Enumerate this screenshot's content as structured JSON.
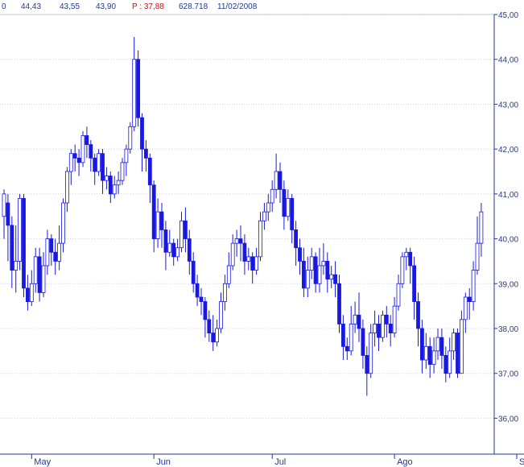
{
  "header": {
    "c0": "0",
    "c1": "44,43",
    "c2": "43,55",
    "c3": "43,90",
    "c4": "P : 37,88",
    "c5": "628.718",
    "c6": "11/02/2008"
  },
  "colors": {
    "up": "#ffffff",
    "down": "#1818e0",
    "wick": "#1818e0",
    "axis": "#203a8f",
    "grid": "#c8cde8"
  },
  "chart_data": {
    "type": "candlestick",
    "ylim": [
      35.2,
      45.0
    ],
    "y_ticks": [
      "36,00",
      "37,00",
      "38,00",
      "39,00",
      "40,00",
      "41,00",
      "42,00",
      "43,00",
      "44,00",
      "45,00"
    ],
    "y_tick_values": [
      36,
      37,
      38,
      39,
      40,
      41,
      42,
      43,
      44,
      45
    ],
    "months": [
      "May",
      "Jun",
      "Jul",
      "Ago",
      "Sep"
    ],
    "month_bar_index": [
      7,
      38,
      68,
      99,
      130
    ],
    "grid": true,
    "candles": [
      [
        40.5,
        41.0,
        40.0,
        41.1
      ],
      [
        40.8,
        40.3,
        39.5,
        41.0
      ],
      [
        40.3,
        39.3,
        38.9,
        40.5
      ],
      [
        39.3,
        39.5,
        38.8,
        40.3
      ],
      [
        39.5,
        40.9,
        39.3,
        41.0
      ],
      [
        40.9,
        38.9,
        38.7,
        41.0
      ],
      [
        38.9,
        38.6,
        38.4,
        39.2
      ],
      [
        38.6,
        39.0,
        38.5,
        39.3
      ],
      [
        39.0,
        39.6,
        38.8,
        39.8
      ],
      [
        39.6,
        38.8,
        38.6,
        39.8
      ],
      [
        38.8,
        39.4,
        38.7,
        39.7
      ],
      [
        39.4,
        40.0,
        39.2,
        40.2
      ],
      [
        40.0,
        39.7,
        39.4,
        40.1
      ],
      [
        39.7,
        39.5,
        39.2,
        40.0
      ],
      [
        39.5,
        39.9,
        39.3,
        40.3
      ],
      [
        39.9,
        40.8,
        39.7,
        40.9
      ],
      [
        40.8,
        41.5,
        40.6,
        41.6
      ],
      [
        41.5,
        41.9,
        41.2,
        42.0
      ],
      [
        41.9,
        41.8,
        41.5,
        42.1
      ],
      [
        41.8,
        41.7,
        41.4,
        42.0
      ],
      [
        41.7,
        42.3,
        41.6,
        42.4
      ],
      [
        42.3,
        42.1,
        41.8,
        42.5
      ],
      [
        42.1,
        41.8,
        41.5,
        42.2
      ],
      [
        41.8,
        41.5,
        41.2,
        41.9
      ],
      [
        41.5,
        41.9,
        41.4,
        42.0
      ],
      [
        41.9,
        41.3,
        41.0,
        42.0
      ],
      [
        41.3,
        41.4,
        41.1,
        41.6
      ],
      [
        41.4,
        41.0,
        40.8,
        41.5
      ],
      [
        41.0,
        41.2,
        40.9,
        41.4
      ],
      [
        41.2,
        41.3,
        41.0,
        41.5
      ],
      [
        41.3,
        41.7,
        41.2,
        41.8
      ],
      [
        41.7,
        42.0,
        41.4,
        42.1
      ],
      [
        42.0,
        42.5,
        41.9,
        42.6
      ],
      [
        42.5,
        44.0,
        42.4,
        44.5
      ],
      [
        44.0,
        42.7,
        42.5,
        44.2
      ],
      [
        42.7,
        42.0,
        41.5,
        42.8
      ],
      [
        42.0,
        41.8,
        41.5,
        42.2
      ],
      [
        41.8,
        41.2,
        40.8,
        41.9
      ],
      [
        41.2,
        40.0,
        39.7,
        41.3
      ],
      [
        40.0,
        40.6,
        39.8,
        40.9
      ],
      [
        40.6,
        40.2,
        39.8,
        40.8
      ],
      [
        40.2,
        39.7,
        39.3,
        40.4
      ],
      [
        39.7,
        39.9,
        39.6,
        40.2
      ],
      [
        39.9,
        39.6,
        39.4,
        40.0
      ],
      [
        39.6,
        39.8,
        39.5,
        40.0
      ],
      [
        39.8,
        40.4,
        39.7,
        40.6
      ],
      [
        40.4,
        40.0,
        39.7,
        40.7
      ],
      [
        40.0,
        39.5,
        39.2,
        40.2
      ],
      [
        39.5,
        39.0,
        38.8,
        39.7
      ],
      [
        39.0,
        38.7,
        38.5,
        39.2
      ],
      [
        38.7,
        38.6,
        38.3,
        38.9
      ],
      [
        38.6,
        38.2,
        37.8,
        38.7
      ],
      [
        38.2,
        37.9,
        37.7,
        38.4
      ],
      [
        37.9,
        37.7,
        37.5,
        38.3
      ],
      [
        37.7,
        38.0,
        37.6,
        38.2
      ],
      [
        38.0,
        38.6,
        37.9,
        38.8
      ],
      [
        38.6,
        39.0,
        38.4,
        39.2
      ],
      [
        39.0,
        39.4,
        38.9,
        39.7
      ],
      [
        39.4,
        39.9,
        39.3,
        40.1
      ],
      [
        39.9,
        40.0,
        39.6,
        40.2
      ],
      [
        40.0,
        39.9,
        39.5,
        40.3
      ],
      [
        39.9,
        39.5,
        39.2,
        40.1
      ],
      [
        39.5,
        39.6,
        39.3,
        39.8
      ],
      [
        39.6,
        39.3,
        39.0,
        39.7
      ],
      [
        39.3,
        39.6,
        39.2,
        39.8
      ],
      [
        39.6,
        40.4,
        39.5,
        40.6
      ],
      [
        40.4,
        40.6,
        40.2,
        40.8
      ],
      [
        40.6,
        40.8,
        40.4,
        41.0
      ],
      [
        40.8,
        41.1,
        40.6,
        41.3
      ],
      [
        41.1,
        41.5,
        40.9,
        41.9
      ],
      [
        41.5,
        41.1,
        40.8,
        41.7
      ],
      [
        41.1,
        40.5,
        40.2,
        41.3
      ],
      [
        40.5,
        40.9,
        40.4,
        41.1
      ],
      [
        40.9,
        40.2,
        39.9,
        41.0
      ],
      [
        40.2,
        39.8,
        39.4,
        40.4
      ],
      [
        39.8,
        39.5,
        39.2,
        40.0
      ],
      [
        39.5,
        38.9,
        38.7,
        39.8
      ],
      [
        38.9,
        39.3,
        38.7,
        39.6
      ],
      [
        39.3,
        39.6,
        39.1,
        39.8
      ],
      [
        39.6,
        39.0,
        38.8,
        39.7
      ],
      [
        39.0,
        39.4,
        38.8,
        39.8
      ],
      [
        39.4,
        39.5,
        39.2,
        39.9
      ],
      [
        39.5,
        39.1,
        38.8,
        39.7
      ],
      [
        39.1,
        39.2,
        38.9,
        39.4
      ],
      [
        39.2,
        39.0,
        38.7,
        39.5
      ],
      [
        39.0,
        38.1,
        37.9,
        39.2
      ],
      [
        38.1,
        37.6,
        37.3,
        38.3
      ],
      [
        37.6,
        37.5,
        37.3,
        37.8
      ],
      [
        37.5,
        38.1,
        37.4,
        38.5
      ],
      [
        38.1,
        38.3,
        37.9,
        38.6
      ],
      [
        38.3,
        38.0,
        37.7,
        38.8
      ],
      [
        38.0,
        37.4,
        37.1,
        38.2
      ],
      [
        37.4,
        37.0,
        36.5,
        37.6
      ],
      [
        37.0,
        37.9,
        36.9,
        38.1
      ],
      [
        37.9,
        38.1,
        37.6,
        38.4
      ],
      [
        38.1,
        37.8,
        37.5,
        38.3
      ],
      [
        37.8,
        38.3,
        37.7,
        38.4
      ],
      [
        38.3,
        38.1,
        37.8,
        38.5
      ],
      [
        38.1,
        37.9,
        37.6,
        38.3
      ],
      [
        37.9,
        38.5,
        37.8,
        38.7
      ],
      [
        38.5,
        39.0,
        38.4,
        39.2
      ],
      [
        39.0,
        39.6,
        38.9,
        39.7
      ],
      [
        39.6,
        39.7,
        39.3,
        39.8
      ],
      [
        39.7,
        39.4,
        39.0,
        39.8
      ],
      [
        39.4,
        38.6,
        38.2,
        39.6
      ],
      [
        38.6,
        38.0,
        37.6,
        38.8
      ],
      [
        38.0,
        37.3,
        37.0,
        38.2
      ],
      [
        37.3,
        37.6,
        37.1,
        37.9
      ],
      [
        37.6,
        37.2,
        36.9,
        37.8
      ],
      [
        37.2,
        37.5,
        37.0,
        37.8
      ],
      [
        37.5,
        37.8,
        37.3,
        38.0
      ],
      [
        37.8,
        37.4,
        37.1,
        38.0
      ],
      [
        37.4,
        37.0,
        36.8,
        37.6
      ],
      [
        37.0,
        37.5,
        36.9,
        37.8
      ],
      [
        37.5,
        37.9,
        37.3,
        38.0
      ],
      [
        37.9,
        37.0,
        36.9,
        38.0
      ],
      [
        37.0,
        38.2,
        37.0,
        38.4
      ],
      [
        38.2,
        38.7,
        37.9,
        38.8
      ],
      [
        38.7,
        38.6,
        38.2,
        38.9
      ],
      [
        38.6,
        39.3,
        38.4,
        39.5
      ],
      [
        39.3,
        39.9,
        39.2,
        40.5
      ],
      [
        39.9,
        40.6,
        39.6,
        40.8
      ]
    ]
  }
}
